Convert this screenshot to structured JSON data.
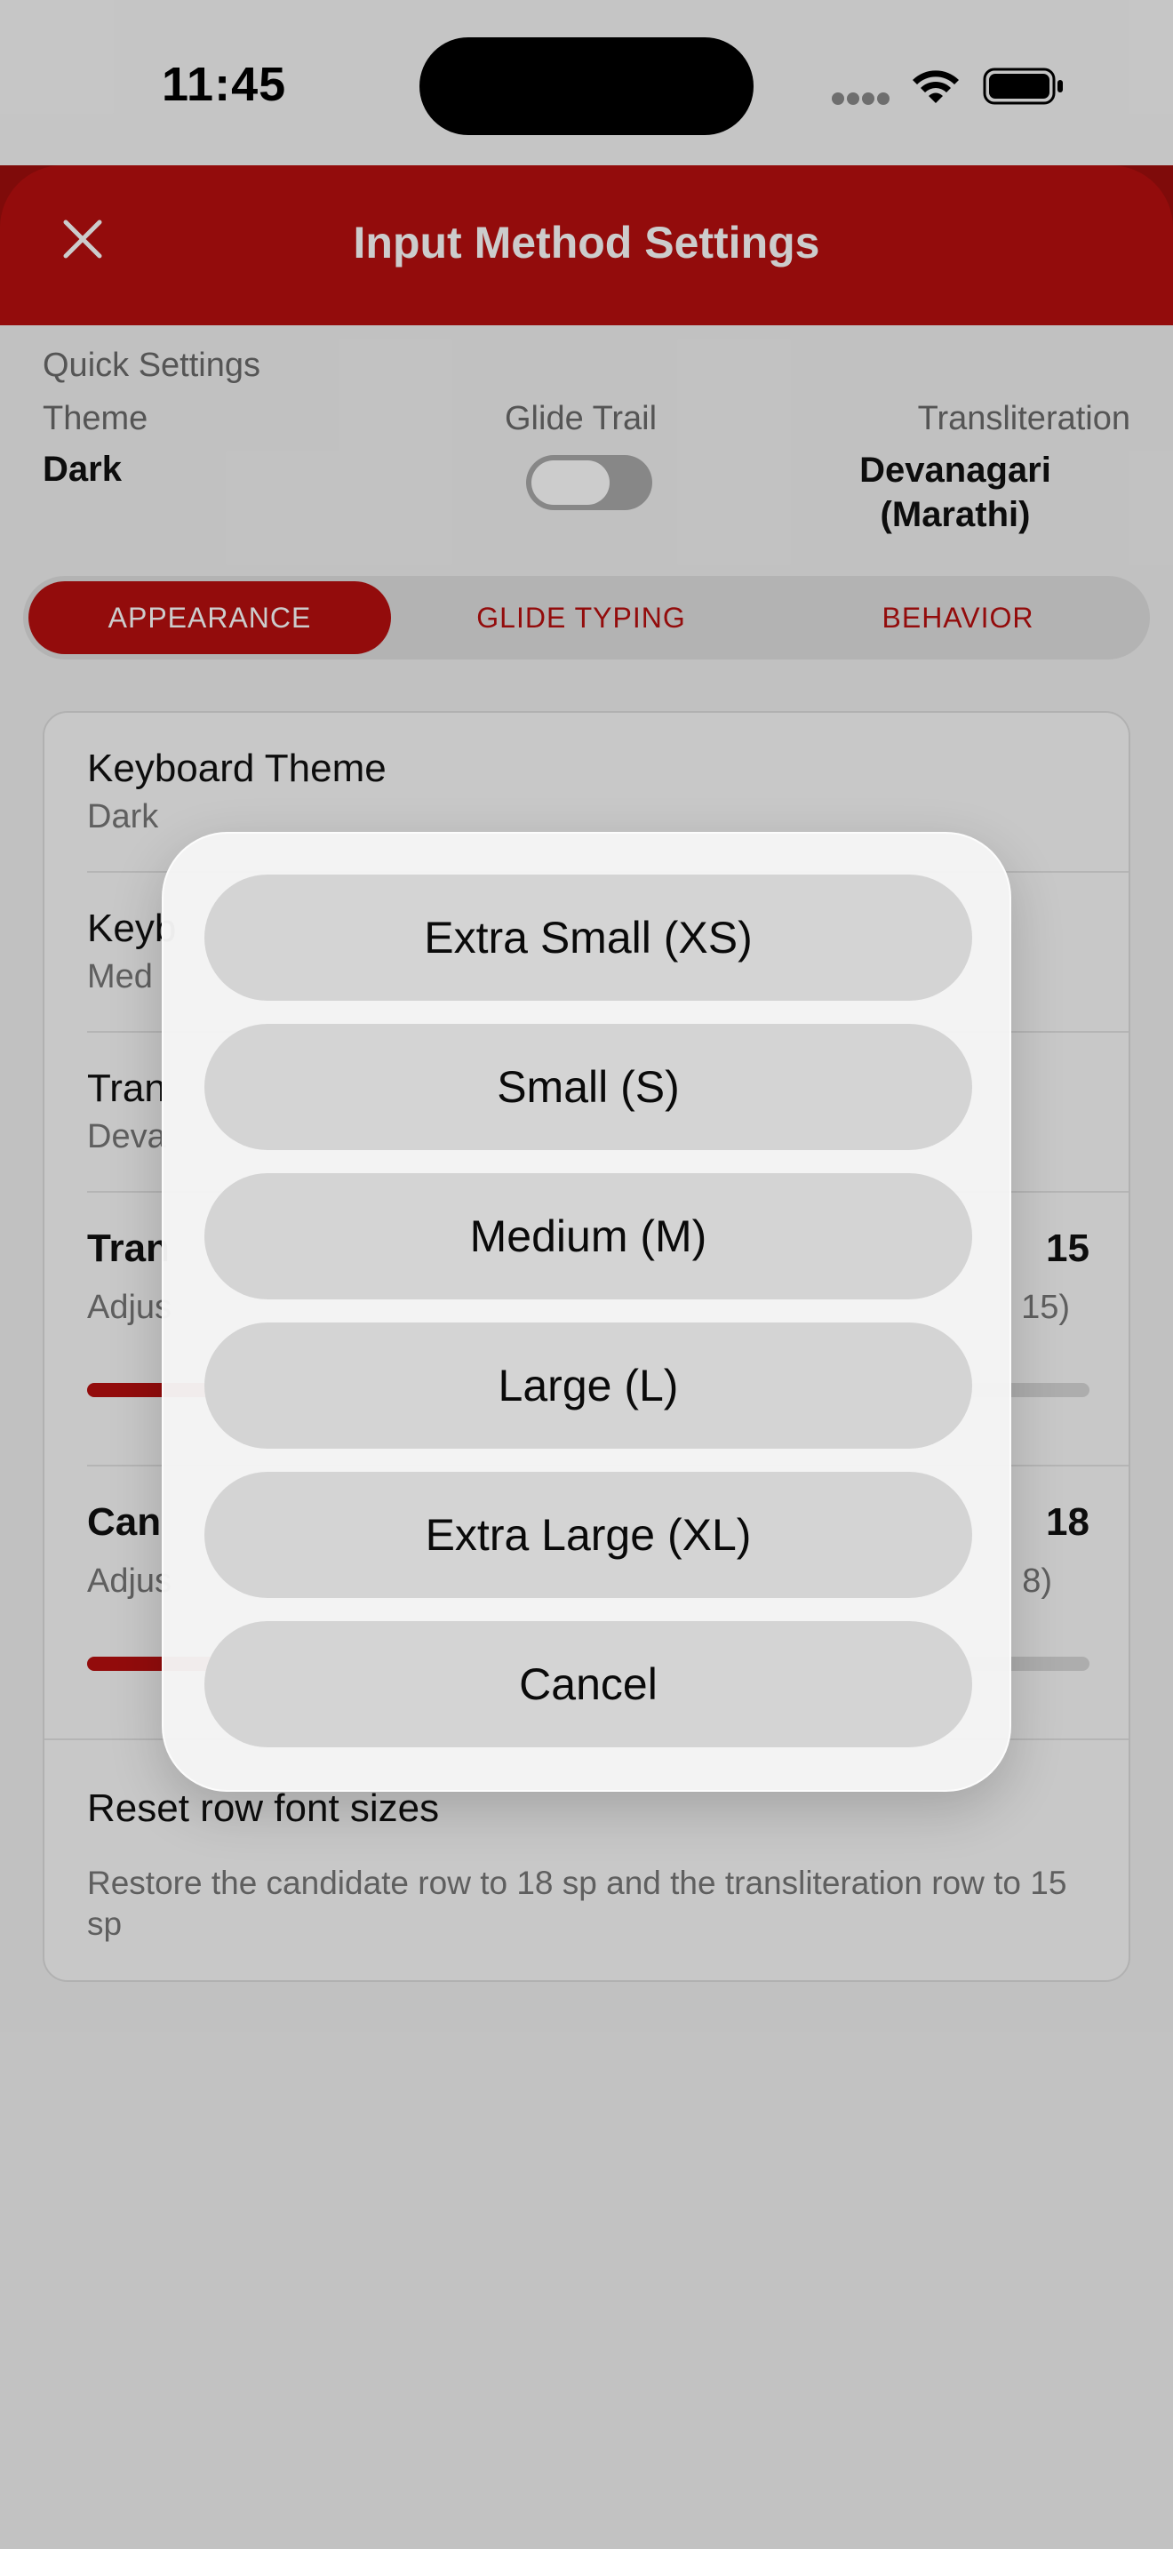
{
  "status_bar": {
    "time": "11:45"
  },
  "header": {
    "title": "Input Method Settings"
  },
  "quick_settings": {
    "label": "Quick Settings",
    "theme": {
      "label": "Theme",
      "value": "Dark"
    },
    "glide_trail": {
      "label": "Glide Trail",
      "enabled": false
    },
    "transliteration": {
      "label": "Transliteration",
      "value_line1": "Devanagari",
      "value_line2": "(Marathi)"
    }
  },
  "tabs": [
    {
      "label": "APPEARANCE",
      "active": true
    },
    {
      "label": "GLIDE TYPING",
      "active": false
    },
    {
      "label": "BEHAVIOR",
      "active": false
    }
  ],
  "settings": {
    "keyboard_theme": {
      "title": "Keyboard Theme",
      "value": "Dark"
    },
    "keyboard_size": {
      "title": "Keyb",
      "value": "Med"
    },
    "transliteration_script": {
      "title": "Tran",
      "value": "Deva"
    },
    "transliteration_font": {
      "title": "Tran",
      "subtitle": "Adjus",
      "subtitle_end": "15)",
      "value": "15",
      "slider_fraction": 0.27
    },
    "candidate_font": {
      "title": "Can",
      "subtitle": "Adjus",
      "subtitle_end": "8)",
      "value": "18",
      "slider_fraction": 0.51
    },
    "reset": {
      "title": "Reset row font sizes",
      "description": "Restore the candidate row to 18 sp and the transliteration row to 15 sp"
    }
  },
  "action_sheet": {
    "options": [
      "Extra Small (XS)",
      "Small (S)",
      "Medium (M)",
      "Large (L)",
      "Extra Large (XL)"
    ],
    "cancel": "Cancel"
  },
  "colors": {
    "accent": "#b8100f",
    "background": "#f2f2f2"
  }
}
